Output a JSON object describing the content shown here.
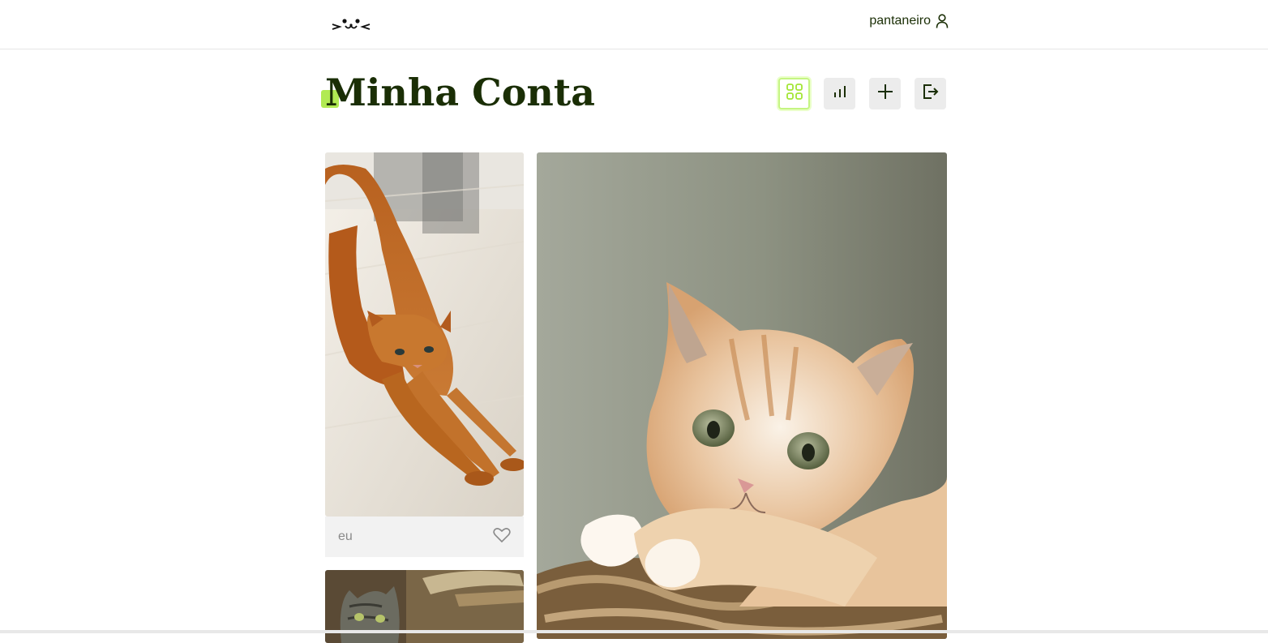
{
  "header": {
    "logo_icon": "cat-face-logo",
    "username": "pantaneiro",
    "user_icon": "person-icon"
  },
  "page": {
    "title": "Minha Conta"
  },
  "actions": [
    {
      "name": "grid-view-button",
      "icon": "grid-icon",
      "active": true
    },
    {
      "name": "stats-button",
      "icon": "bar-chart-icon",
      "active": false
    },
    {
      "name": "add-post-button",
      "icon": "plus-icon",
      "active": false
    },
    {
      "name": "logout-button",
      "icon": "logout-icon",
      "active": false
    }
  ],
  "feed": [
    {
      "name": "photo-orange-cat-stretching",
      "caption": "eu",
      "like_icon": "heart-icon"
    },
    {
      "name": "photo-cream-kitten"
    },
    {
      "name": "photo-tabby-cat"
    }
  ],
  "colors": {
    "text_dark": "#1a2e05",
    "accent": "#a3e635",
    "button_bg": "#ececec",
    "caption_bg": "#f2f2f2"
  }
}
